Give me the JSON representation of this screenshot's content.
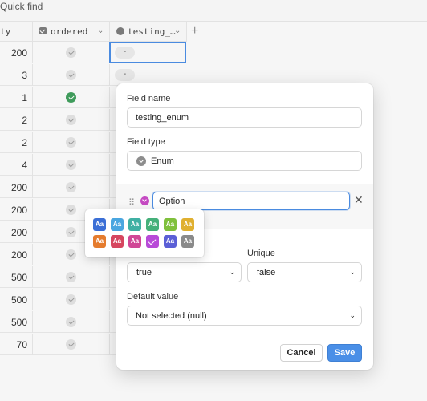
{
  "toolbar": {
    "quick_find": "Quick find"
  },
  "columns": [
    {
      "label": "ty"
    },
    {
      "label": "ordered"
    },
    {
      "label": "testing_…"
    }
  ],
  "add_column": "+",
  "rows": [
    {
      "value": "200",
      "ordered": false,
      "enum": "-"
    },
    {
      "value": "3",
      "ordered": false,
      "enum": "-"
    },
    {
      "value": "1",
      "ordered": true,
      "enum": ""
    },
    {
      "value": "2",
      "ordered": false,
      "enum": ""
    },
    {
      "value": "2",
      "ordered": false,
      "enum": ""
    },
    {
      "value": "4",
      "ordered": false,
      "enum": ""
    },
    {
      "value": "200",
      "ordered": false,
      "enum": ""
    },
    {
      "value": "200",
      "ordered": false,
      "enum": ""
    },
    {
      "value": "200",
      "ordered": false,
      "enum": ""
    },
    {
      "value": "200",
      "ordered": false,
      "enum": ""
    },
    {
      "value": "500",
      "ordered": false,
      "enum": ""
    },
    {
      "value": "500",
      "ordered": false,
      "enum": ""
    },
    {
      "value": "500",
      "ordered": false,
      "enum": ""
    },
    {
      "value": "70",
      "ordered": false,
      "enum": ""
    }
  ],
  "dialog": {
    "field_name_label": "Field name",
    "field_name_value": "testing_enum",
    "field_type_label": "Field type",
    "field_type_value": "Enum",
    "option_value": "Option",
    "unique_label": "Unique",
    "required_value": "true",
    "unique_value": "false",
    "default_label": "Default value",
    "default_value": "Not selected (null)",
    "cancel_label": "Cancel",
    "save_label": "Save"
  },
  "palette": {
    "swatch_text": "Aa",
    "colors": [
      "#3b6fd6",
      "#4aa6e0",
      "#3fb0a3",
      "#45b07a",
      "#7fc03c",
      "#e0b030",
      "#e57c2e",
      "#d6465f",
      "#d04796",
      "#b84bd8",
      "#5b5fd6",
      "#8a8a8a"
    ],
    "selected_index": 9
  }
}
